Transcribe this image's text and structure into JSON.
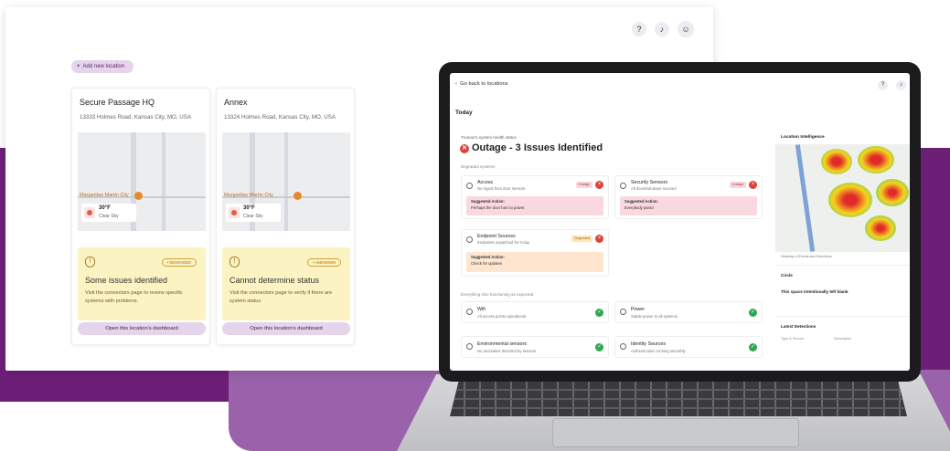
{
  "colors": {
    "purple_bg": "#6d1f78",
    "purple_light": "#9a62aa",
    "button_pill": "#e6d3ec",
    "warning_bg": "#fbf4c2",
    "outage_red": "#e0423a",
    "ok_green": "#2fa84f"
  },
  "back_window": {
    "add_button_label": "Add new location",
    "top_icons": [
      "help-icon",
      "bell-icon",
      "user-icon"
    ],
    "locations": [
      {
        "name": "Secure Passage HQ",
        "address": "13333 Holmes Road, Kansas City, MO, USA",
        "map_label": "Margaritas Martin City",
        "weather_temp": "30°F",
        "weather_cond": "Clear Sky",
        "status_badge": "• DEGRADED",
        "status_title": "Some issues identified",
        "status_desc": "Visit the connectors page to review specific systems with problems.",
        "dashboard_button": "Open this location's dashboard"
      },
      {
        "name": "Annex",
        "address": "13324 Holmes Road, Kansas City, MO, USA",
        "map_label": "Margaritas Martin City",
        "weather_temp": "30°F",
        "weather_cond": "Clear Sky",
        "status_badge": "• UNKNOWN",
        "status_title": "Cannot determine status",
        "status_desc": "Visit the connectors page to verify if there are system status",
        "dashboard_button": "Open this location's dashboard"
      }
    ]
  },
  "laptop": {
    "back_link": "Go back to locations",
    "section_title": "Today",
    "health_label": "Truman's system health status",
    "headline": "Outage - 3 Issues Identified",
    "degraded_label": "Degraded systems",
    "degraded_systems": [
      {
        "title": "Access",
        "desc": "No signal from door sensors",
        "badge": "Outage",
        "action_label": "Suggested Action:",
        "action_text": "Perhaps the door has no power."
      },
      {
        "title": "Security Sensors",
        "desc": "All doors/windows secured",
        "badge": "Outage",
        "action_label": "Suggested Action:",
        "action_text": "Everybody panic!"
      },
      {
        "title": "Endpoint Sources",
        "desc": "Endpoints unpatched for 0-day",
        "badge": "Degraded",
        "action_label": "Suggested Action:",
        "action_text": "Check for updates"
      }
    ],
    "ok_label": "Everything else functioning as expected",
    "ok_systems": [
      {
        "title": "Wifi",
        "desc": "All access points operational"
      },
      {
        "title": "Power",
        "desc": "Stable power to all systems"
      },
      {
        "title": "Environmental sensors",
        "desc": "No anomalies detected by sensors"
      },
      {
        "title": "Identity Sources",
        "desc": "Authentication running smoothly"
      }
    ],
    "intel_title": "Location Intelligence",
    "map_caption": "Heatmap of Events and Detections",
    "circle_title": "Circle",
    "circle_text": "This space intentionally left blank",
    "detections_title": "Latest Detections",
    "detections_cols": [
      "Type & Source",
      "Description"
    ]
  }
}
